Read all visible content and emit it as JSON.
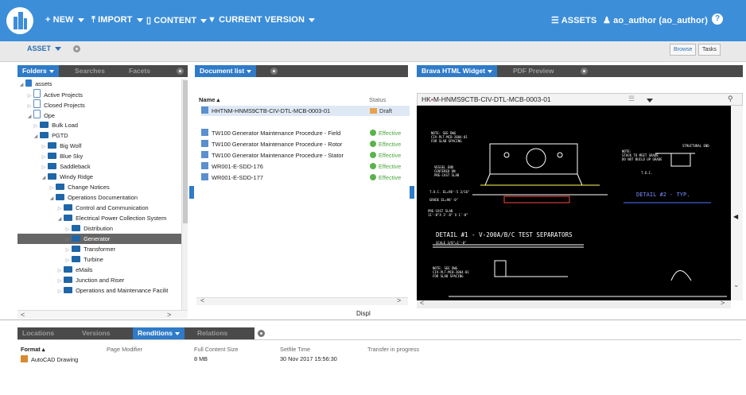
{
  "topbar": {
    "new_label": "+ NEW",
    "import_label": "IMPORT",
    "content_label": "CONTENT",
    "current_version_label": "CURRENT VERSION",
    "assets_label": "ASSETS",
    "user_label": "ao_author (ao_author)",
    "accent": "#3c8ed9"
  },
  "subbar": {
    "asset_menu": "ASSET",
    "browse": "Browse",
    "tasks": "Tasks"
  },
  "left_panel": {
    "tabs": [
      "Folders",
      "Searches",
      "Facets"
    ]
  },
  "tree": [
    {
      "label": "assets",
      "icon": "assets-icon",
      "twisty": "◢"
    },
    {
      "label": "Active Projects",
      "icon": "project-icon",
      "twisty": "▷"
    },
    {
      "label": "Closed Projects",
      "icon": "project-icon",
      "twisty": "▷"
    },
    {
      "label": "Ope",
      "icon": "project-icon",
      "twisty": "◢"
    },
    {
      "label": "Bulk Load",
      "icon": "folder-icon",
      "twisty": "▷"
    },
    {
      "label": "PGTD",
      "icon": "folder-icon",
      "twisty": "◢"
    },
    {
      "label": "Big Wolf",
      "icon": "folder-icon",
      "twisty": "▷"
    },
    {
      "label": "Blue Sky",
      "icon": "folder-icon",
      "twisty": "▷"
    },
    {
      "label": "Saddleback",
      "icon": "folder-icon",
      "twisty": "▷"
    },
    {
      "label": "Windy Ridge",
      "icon": "folder-icon",
      "twisty": "◢"
    },
    {
      "label": "Change Notices",
      "icon": "folder-icon",
      "twisty": "▷"
    },
    {
      "label": "Operations Documentation",
      "icon": "folder-icon",
      "twisty": "◢"
    },
    {
      "label": "Control and Communication",
      "icon": "folder-icon",
      "twisty": "▷"
    },
    {
      "label": "Electrical Power Collection System",
      "icon": "folder-icon",
      "twisty": "◢"
    },
    {
      "label": "Distribution",
      "icon": "folder-icon",
      "twisty": "▷"
    },
    {
      "label": "Generator",
      "icon": "folder-icon",
      "twisty": "▷"
    },
    {
      "label": "Transformer",
      "icon": "folder-icon",
      "twisty": "▷"
    },
    {
      "label": "Turbine",
      "icon": "folder-icon",
      "twisty": "▷"
    },
    {
      "label": "eMails",
      "icon": "folder-icon",
      "twisty": "▷"
    },
    {
      "label": "Junction and Riser",
      "icon": "folder-icon",
      "twisty": "▷"
    },
    {
      "label": "Operations and Maintenance Facilit",
      "icon": "folder-icon",
      "twisty": "▷"
    }
  ],
  "doclist": {
    "tab": "Document list",
    "col_name": "Name ▴",
    "col_status": "Status",
    "rows": [
      {
        "name": "HHTNM-HNMS9CTB-CIV-DTL-MCB-0003-01",
        "status": "Draft"
      },
      {
        "name": "TW100 Generator Maintenance Procedure - Field",
        "status": "Effective"
      },
      {
        "name": "TW100 Generator Maintenance Procedure - Rotor",
        "status": "Effective"
      },
      {
        "name": "TW100 Generator Maintenance Procedure - Stator",
        "status": "Effective"
      },
      {
        "name": "WR001-E-SDD-176",
        "status": "Effective"
      },
      {
        "name": "WR001-E-SDD-177",
        "status": "Effective"
      }
    ]
  },
  "viewer": {
    "tabs": [
      "Brava HTML Widget",
      "PDF Preview"
    ],
    "doc_title": "HK",
    "doc_title_rest": "M-HNMS9CTB-CIV-DTL-MCB-0003-01",
    "cad_detail1": "DETAIL #1 - V-200A/B/C TEST SEPARATORS",
    "cad_detail1_scale": "SCALE 3/8\"=1'-0\"",
    "cad_detail2": "DETAIL #2 - TYP.",
    "cad_note1": "NOTE: SEE DWG\nCIV-PLT-MCB-2004-01\nFOR SLAB SPACING",
    "cad_note2": "NOTE:\nSTACK TO MEET GRADE\nDO NOT BUILD UP GRADE",
    "cad_structural": "STRUCTURAL END",
    "cad_vessel": "VESSEL END\nCENTERED ON\nPRE-CAST SLAB",
    "cad_tos": "T.O.C. EL=98'-5 3/16\"",
    "cad_grade": "GRADE EL=98'-0\"",
    "cad_precast": "PRE-CAST SLAB\n11'-0\"X 3'-8\" X 1'-0\"",
    "cad_toc": "T.O.C."
  },
  "display": {
    "label": "Displ"
  },
  "bottom": {
    "tabs": [
      "Locations",
      "Versions",
      "Renditions",
      "Relations"
    ],
    "headers": [
      "Format ▴",
      "Page Modifier",
      "Full Content Size",
      "Setfile Time",
      "Transfer in progress"
    ],
    "row": {
      "format": "AutoCAD Drawing",
      "size": "8 MB",
      "time": "30 Nov 2017 15:56:30"
    }
  }
}
